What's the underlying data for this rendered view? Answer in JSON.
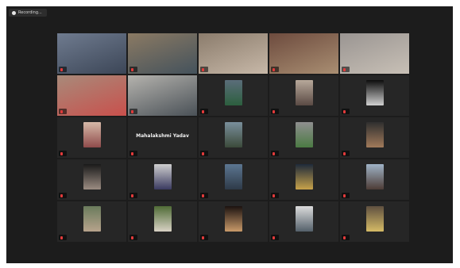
{
  "recording": {
    "label": "Recording..."
  },
  "tiles": [
    {
      "name": "",
      "type": "video",
      "colors": [
        "#6f7b8f",
        "#3c4657"
      ],
      "active": false
    },
    {
      "name": "",
      "type": "video",
      "colors": [
        "#8b7a63",
        "#44525c"
      ],
      "active": true
    },
    {
      "name": "",
      "type": "video",
      "colors": [
        "#8b7c6c",
        "#c7b8a8"
      ],
      "active": false
    },
    {
      "name": "",
      "type": "video",
      "colors": [
        "#6d4b3e",
        "#a98e72"
      ],
      "active": false
    },
    {
      "name": "",
      "type": "video",
      "colors": [
        "#9a9592",
        "#c8c0b6"
      ],
      "active": false
    },
    {
      "name": "",
      "type": "video",
      "colors": [
        "#a88a7a",
        "#c9504c"
      ],
      "active": false
    },
    {
      "name": "",
      "type": "video",
      "colors": [
        "#b5b3ae",
        "#4a5157"
      ],
      "active": false
    },
    {
      "name": "",
      "type": "photo",
      "colors": [
        "#5b6d7a",
        "#2c5f3e"
      ],
      "active": false
    },
    {
      "name": "",
      "type": "photo",
      "colors": [
        "#b7a89a",
        "#5a4a44"
      ],
      "active": false
    },
    {
      "name": "",
      "type": "photo",
      "colors": [
        "#0d0d0d",
        "#d0d0d0"
      ],
      "active": false
    },
    {
      "name": "",
      "type": "photo",
      "colors": [
        "#d6b9a8",
        "#8f4b4b"
      ],
      "active": false
    },
    {
      "name": "",
      "type": "text",
      "center": "Mahalakshmi Yadav",
      "active": false
    },
    {
      "name": "",
      "type": "photo",
      "colors": [
        "#7a8f9c",
        "#3b4a3a"
      ],
      "active": false
    },
    {
      "name": "",
      "type": "photo",
      "colors": [
        "#8f8f8f",
        "#4b7a43"
      ],
      "active": false
    },
    {
      "name": "",
      "type": "photo",
      "colors": [
        "#2f2f2f",
        "#a17a5a"
      ],
      "active": false
    },
    {
      "name": "",
      "type": "photo",
      "colors": [
        "#1a1a1a",
        "#9b8c82"
      ],
      "active": false
    },
    {
      "name": "",
      "type": "photo",
      "colors": [
        "#cfcfcf",
        "#3a3a60"
      ],
      "active": false
    },
    {
      "name": "",
      "type": "photo",
      "colors": [
        "#5c7691",
        "#2e3a48"
      ],
      "active": false
    },
    {
      "name": "",
      "type": "photo",
      "colors": [
        "#1e2a3a",
        "#c7a24a"
      ],
      "active": false
    },
    {
      "name": "",
      "type": "photo",
      "colors": [
        "#9fb3c7",
        "#4d3c36"
      ],
      "active": false
    },
    {
      "name": "",
      "type": "photo",
      "colors": [
        "#6a7b5c",
        "#b7a38c"
      ],
      "active": false
    },
    {
      "name": "",
      "type": "photo",
      "colors": [
        "#4f6b36",
        "#d8d2c4"
      ],
      "active": false
    },
    {
      "name": "",
      "type": "photo",
      "colors": [
        "#1b1210",
        "#c99a6a"
      ],
      "active": false
    },
    {
      "name": "",
      "type": "photo",
      "colors": [
        "#dcdcdc",
        "#54606a"
      ],
      "active": false
    },
    {
      "name": "",
      "type": "photo",
      "colors": [
        "#5f5040",
        "#d5bb66"
      ],
      "active": false
    }
  ]
}
